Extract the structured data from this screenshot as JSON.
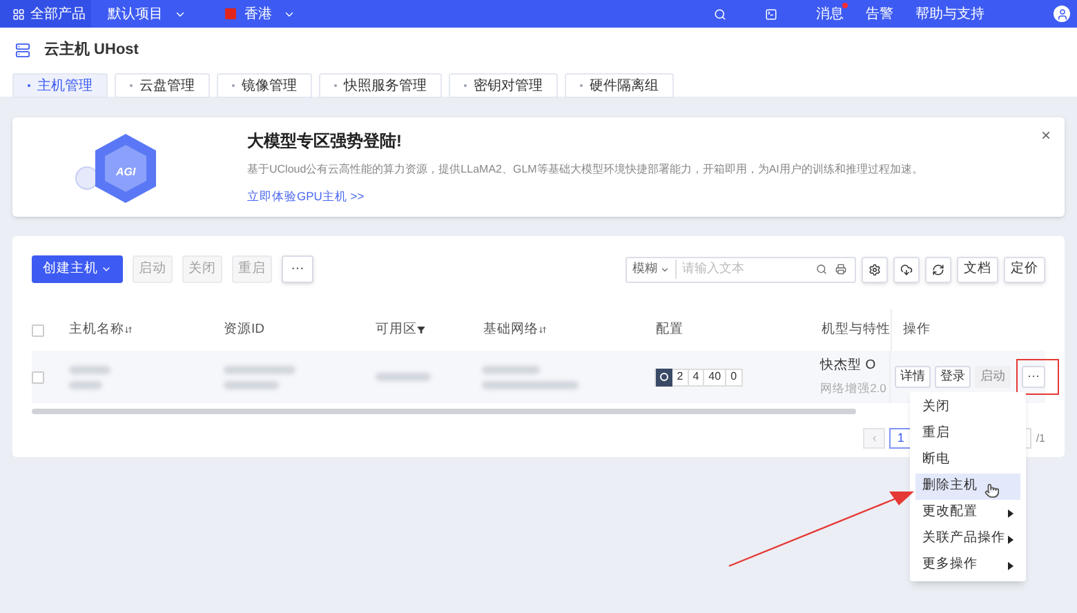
{
  "topbar": {
    "products": "全部产品",
    "project": "默认项目",
    "region": "香港",
    "links": [
      {
        "label": "消息",
        "badge": true
      },
      {
        "label": "告警",
        "badge": false
      },
      {
        "label": "帮助与支持",
        "badge": false
      }
    ]
  },
  "page": {
    "title": "云主机 UHost"
  },
  "tabs": [
    {
      "label": "主机管理",
      "selected": true
    },
    {
      "label": "云盘管理",
      "selected": false
    },
    {
      "label": "镜像管理",
      "selected": false
    },
    {
      "label": "快照服务管理",
      "selected": false
    },
    {
      "label": "密钥对管理",
      "selected": false
    },
    {
      "label": "硬件隔离组",
      "selected": false
    }
  ],
  "banner": {
    "logo": "AGI",
    "title": "大模型专区强势登陆!",
    "text": "基于UCloud公有云高性能的算力资源，提供LLaMA2、GLM等基础大模型环境快捷部署能力，开箱即用，为AI用户的训练和推理过程加速。",
    "link": "立即体验GPU主机 >>",
    "close": "×"
  },
  "toolbar": {
    "buttons": [
      {
        "label": "创建主机",
        "kind": "primary",
        "disabled": false
      },
      {
        "label": "启动",
        "kind": "plain",
        "disabled": true
      },
      {
        "label": "关闭",
        "kind": "plain",
        "disabled": true
      },
      {
        "label": "重启",
        "kind": "plain",
        "disabled": true
      },
      {
        "label": "···",
        "kind": "more",
        "disabled": false
      }
    ],
    "search": {
      "mode": "模糊",
      "placeholder": "请输入文本"
    },
    "right_buttons": [
      "文档",
      "定价"
    ]
  },
  "table": {
    "all_checked": false,
    "columns": [
      {
        "label": "主机名称",
        "kind": "sortable"
      },
      {
        "label": "资源ID",
        "kind": "plain"
      },
      {
        "label": "可用区",
        "kind": "filterable"
      },
      {
        "label": "基础网络",
        "kind": "sortable"
      },
      {
        "label": "配置",
        "kind": "plain"
      },
      {
        "label": "机型与特性",
        "kind": "plain"
      },
      {
        "label": "操作",
        "kind": "plain"
      }
    ],
    "rows": [
      {
        "checked": false,
        "config": [
          "2",
          "4",
          "40",
          "0"
        ],
        "type": "快杰型 O",
        "feature": "网络增强2.0",
        "actions": [
          {
            "label": "详情",
            "disabled": false
          },
          {
            "label": "登录",
            "disabled": false
          },
          {
            "label": "启动",
            "disabled": true
          },
          {
            "label": "···",
            "disabled": false
          }
        ]
      }
    ]
  },
  "pagination": {
    "prev": "‹",
    "page": "1",
    "total": "/1"
  },
  "menu": [
    {
      "label": "关闭",
      "kind": "item",
      "selected": false
    },
    {
      "label": "重启",
      "kind": "item",
      "selected": false
    },
    {
      "label": "断电",
      "kind": "item",
      "selected": false
    },
    {
      "label": "删除主机",
      "kind": "item",
      "selected": true
    },
    {
      "label": "更改配置",
      "kind": "submenu",
      "selected": false
    },
    {
      "label": "关联产品操作",
      "kind": "submenu",
      "selected": false
    },
    {
      "label": "更多操作",
      "kind": "submenu",
      "selected": false
    }
  ]
}
